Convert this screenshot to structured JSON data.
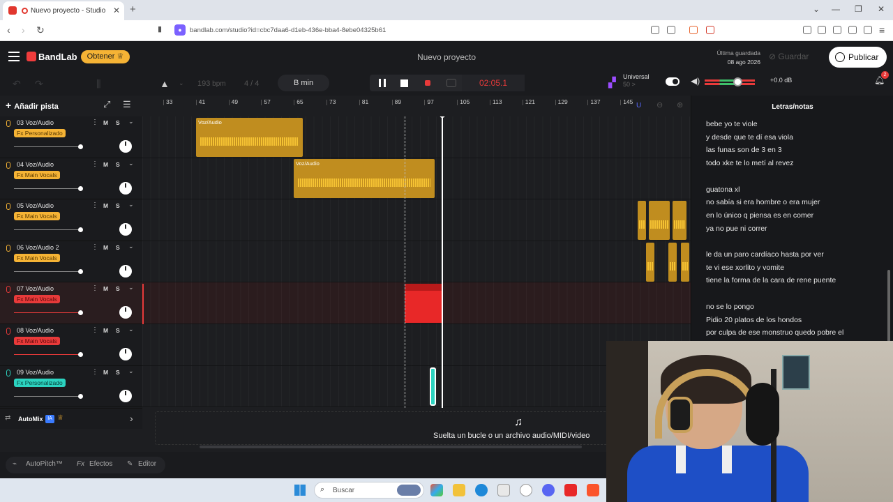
{
  "browser": {
    "tab_title": "Nuevo proyecto - Studio",
    "tab_close": "✕",
    "new_tab": "+",
    "url": "bandlab.com/studio?id=cbc7daa6-d1eb-436e-bba4-8ebe04325b61",
    "window_controls": [
      "⌄",
      "—",
      "❐",
      "✕"
    ]
  },
  "app": {
    "brand": "BandLab",
    "upgrade_label": "Obtener ♕",
    "project_title": "Nuevo proyecto",
    "last_saved_label": "Última guardada",
    "last_saved_date": "08 ago 2026",
    "save_label": "Guardar",
    "publish_label": "Publicar"
  },
  "transport": {
    "bpm_value": "193",
    "bpm_unit": "bpm",
    "time_signature": "4 / 4",
    "key": "B min",
    "time": "02:05.1",
    "universal_label": "Universal",
    "universal_sub": "50 >",
    "volume_db": "+0.0 dB",
    "volume_level": 0.62,
    "notifications": "2"
  },
  "tracks_header": {
    "add_track": "Añadir pista"
  },
  "ruler": [
    "33",
    "41",
    "49",
    "57",
    "65",
    "73",
    "81",
    "89",
    "97",
    "105",
    "113",
    "121",
    "129",
    "137",
    "145"
  ],
  "tracks": [
    {
      "name": "03  Voz/Audio",
      "fx": "Fx Personalizado",
      "mute": "M",
      "solo": "S",
      "color": "#f5b335"
    },
    {
      "name": "04  Voz/Audio",
      "fx": "Fx Main Vocals",
      "mute": "M",
      "solo": "S",
      "color": "#f5b335"
    },
    {
      "name": "05  Voz/Audio",
      "fx": "Fx Main Vocals",
      "mute": "M",
      "solo": "S",
      "color": "#f5b335"
    },
    {
      "name": "06  Voz/Audio 2",
      "fx": "Fx Main Vocals",
      "mute": "M",
      "solo": "S",
      "color": "#f5b335"
    },
    {
      "name": "07  Voz/Audio",
      "fx": "Fx Main Vocals",
      "mute": "M",
      "solo": "S",
      "color": "#e83a3a"
    },
    {
      "name": "08  Voz/Audio",
      "fx": "Fx Main Vocals",
      "mute": "M",
      "solo": "S",
      "color": "#e83a3a"
    },
    {
      "name": "09  Voz/Audio",
      "fx": "Fx Personalizado",
      "mute": "M",
      "solo": "S",
      "color": "#2cd3c0"
    }
  ],
  "clips": {
    "clip1_label": "Voz/Audio",
    "clip2_label": "Voz/Audio"
  },
  "automix": {
    "label": "AutoMix",
    "badge": "IA"
  },
  "drop_zone": {
    "text": "Suelta un bucle o un archivo audio/MIDI/video"
  },
  "lyrics": {
    "title": "Letras/notas",
    "lines": [
      "bebe yo te viole",
      "y desde que te dí esa viola",
      "las funas son de 3 en 3",
      "todo xke te lo metí al revez",
      "",
      "guatona xl",
      "no sabía si era hombre o era mujer",
      "en lo único q piensa es en comer",
      "ya no pue ni correr",
      "",
      "le da un paro cardíaco hasta por ver",
      "te vi ese xorlito y vomite",
      "tiene la forma de la cara de rene puente",
      "",
      "no se lo pongo",
      "Pidio 20 platos de los hondos",
      "por culpa de ese monstruo quedo pobre el"
    ]
  },
  "bottom_tools": {
    "autopitch": "AutoPitch™",
    "effects": "Efectos",
    "editor": "Editor"
  },
  "taskbar": {
    "search_placeholder": "Buscar"
  }
}
